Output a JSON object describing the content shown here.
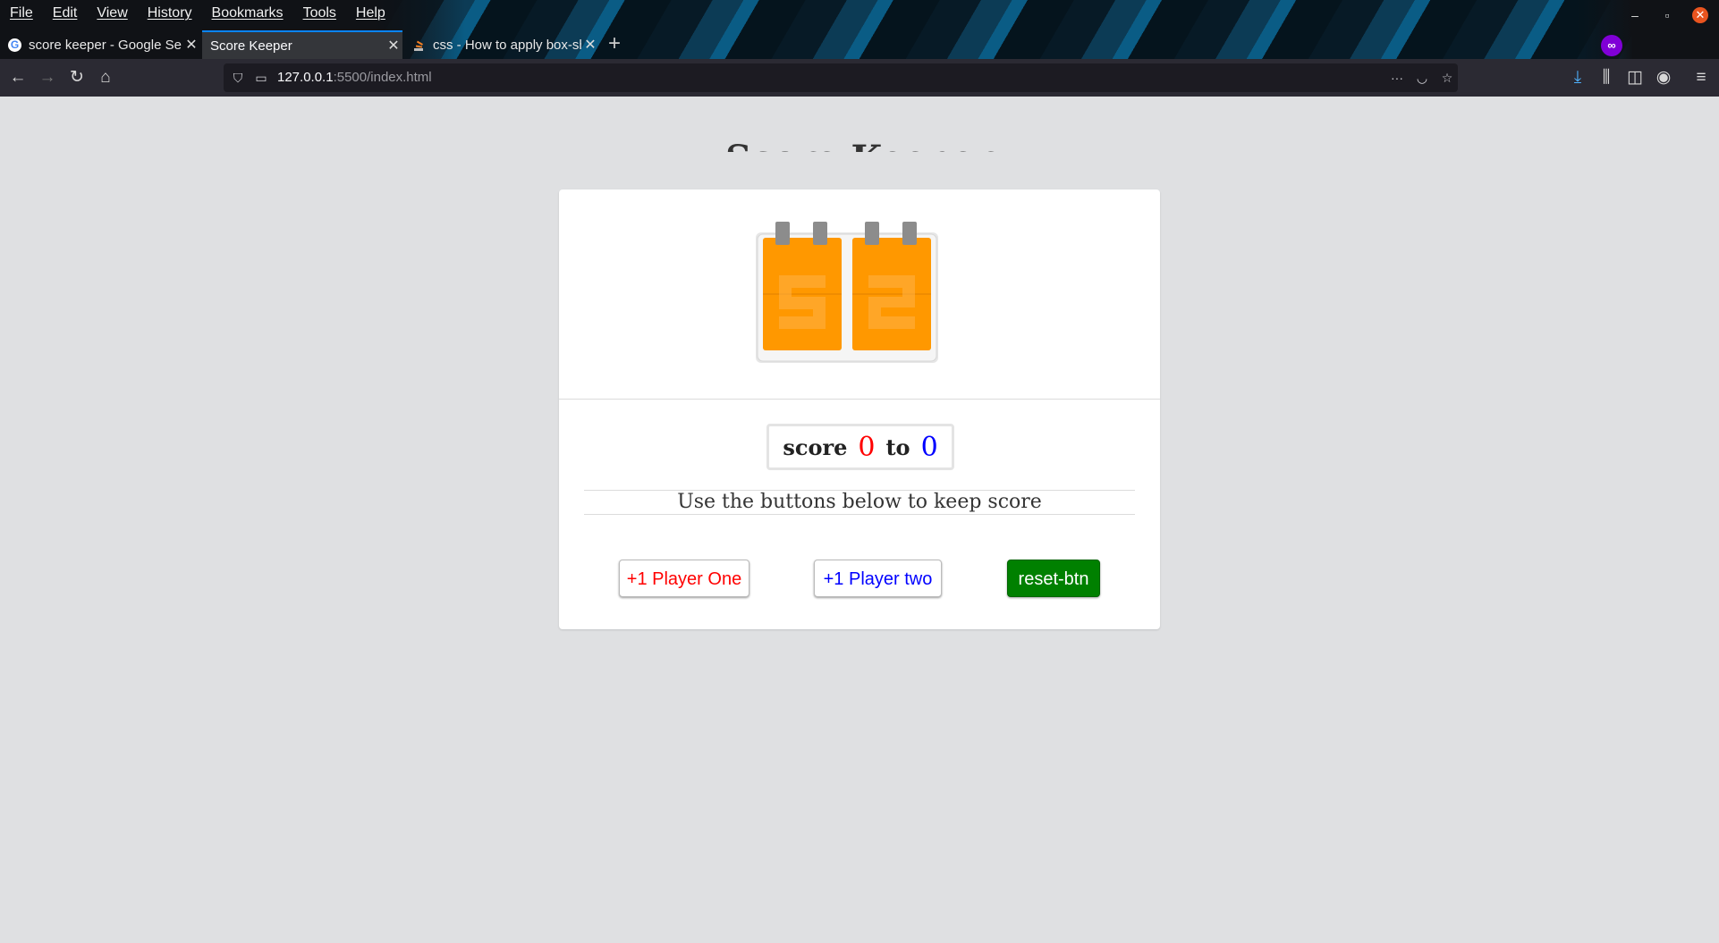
{
  "browser": {
    "menu": [
      "File",
      "Edit",
      "View",
      "History",
      "Bookmarks",
      "Tools",
      "Help"
    ],
    "tabs": [
      {
        "title": "score keeper - Google Se",
        "favicon": "google-icon",
        "active": false
      },
      {
        "title": "Score Keeper",
        "favicon": "",
        "active": true
      },
      {
        "title": "css - How to apply box-sh",
        "favicon": "stackoverflow-icon",
        "active": false
      }
    ],
    "new_tab_label": "+",
    "url_host": "127.0.0.1",
    "url_rest": ":5500/index.html",
    "colors": {
      "accent": "#0a84ff",
      "toolbar": "#2b2a33",
      "urlbar": "#1c1b22",
      "private": "#8000d7",
      "close": "#e9541f"
    }
  },
  "page": {
    "heading": "Score Keeper",
    "scoreboard": {
      "label": "score",
      "player_one_score": "0",
      "separator": "to",
      "player_two_score": "0"
    },
    "instructions": "Use the buttons below to keep score",
    "buttons": {
      "player_one": "+1 Player One",
      "player_two": "+1 Player two",
      "reset": "reset-btn"
    },
    "logo": {
      "left_digit": "5",
      "right_digit": "2",
      "color": "#ff9800"
    },
    "colors": {
      "player_one": "#ff0000",
      "player_two": "#0000ff",
      "reset_bg": "#008000",
      "background": "#dfe0e2"
    }
  }
}
